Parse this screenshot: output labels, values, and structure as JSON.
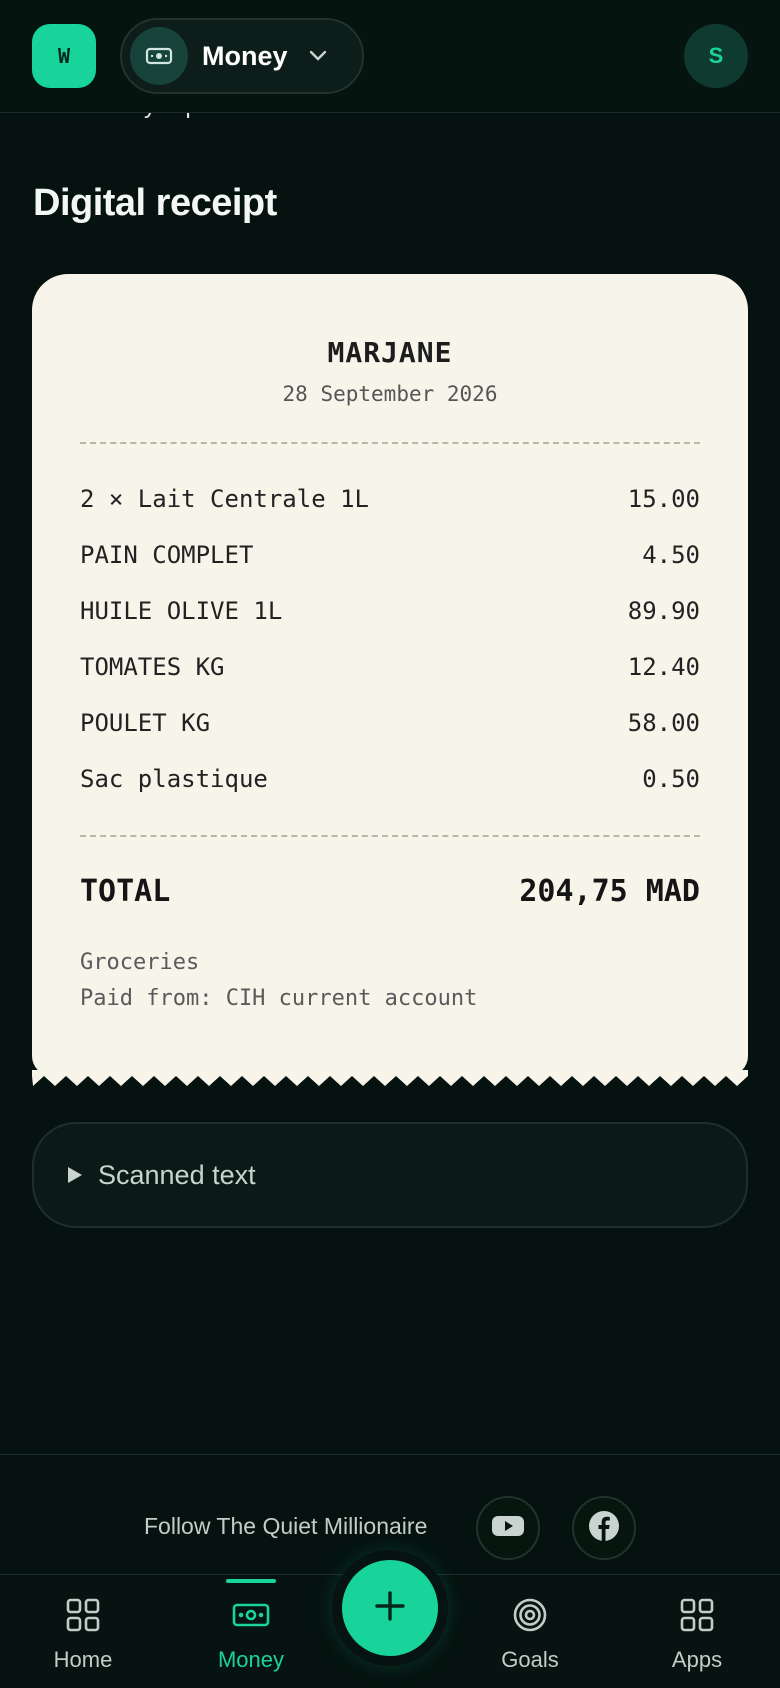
{
  "header": {
    "logo_text": "W",
    "app_name": "Money",
    "avatar_initial": "S"
  },
  "back_link": "Money & pockets",
  "page_title": "Digital receipt",
  "receipt": {
    "store": "MARJANE",
    "date": "28 September 2026",
    "items": [
      {
        "name": "2 × Lait Centrale 1L",
        "price": "15.00"
      },
      {
        "name": "PAIN COMPLET",
        "price": "4.50"
      },
      {
        "name": "HUILE OLIVE 1L",
        "price": "89.90"
      },
      {
        "name": "TOMATES KG",
        "price": "12.40"
      },
      {
        "name": "POULET KG",
        "price": "58.00"
      },
      {
        "name": "Sac plastique",
        "price": "0.50"
      }
    ],
    "total_label": "TOTAL",
    "total_value": "204,75 MAD",
    "category": "Groceries",
    "paid_from": "Paid from: CIH current account"
  },
  "scanned_text_label": "Scanned text",
  "follow": {
    "text": "Follow The Quiet Millionaire",
    "icons": [
      "youtube-icon",
      "facebook-icon"
    ]
  },
  "nav": {
    "items": [
      {
        "label": "Home",
        "icon": "grid-icon"
      },
      {
        "label": "Money",
        "icon": "banknote-icon"
      },
      {
        "label": "Goals",
        "icon": "target-icon"
      },
      {
        "label": "Apps",
        "icon": "apps-icon"
      }
    ],
    "active": "Money",
    "fab_icon": "plus-icon"
  },
  "colors": {
    "background": "#051210",
    "accent": "#19d49a",
    "receipt_paper": "#f7f4ea"
  }
}
